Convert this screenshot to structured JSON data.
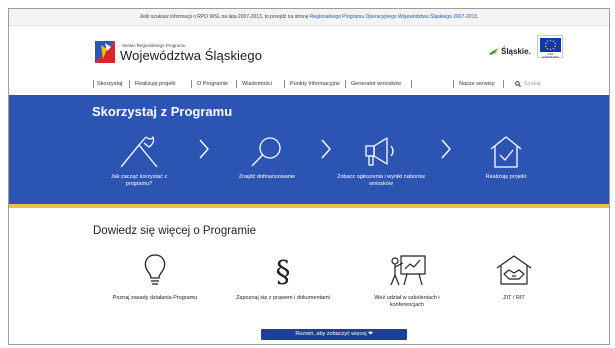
{
  "info_bar": {
    "prefix": "Jeśli szukasz informacji o RPO WSL na lata 2007-2013, to przejdź na stronę ",
    "link": "Regionalnego Programu Operacyjnego Województwa Śląskiego 2007-2013."
  },
  "header": {
    "subtitle": "Serwis Regionalnego Programu",
    "title": "Województwa Śląskiego",
    "brand": "Śląskie.",
    "eu_caption": "UNIA EUROPEJSKA"
  },
  "nav": {
    "items": [
      "Skorzystaj",
      "Realizuję projekt",
      "O Programie",
      "Wiadomości",
      "Punkty Informacyjne",
      "Generator wniosków"
    ],
    "services": "Nasze serwisy",
    "search_placeholder": "Szukaj"
  },
  "program": {
    "title": "Skorzystaj z Programu",
    "steps": [
      {
        "label": "Jak zacząć korzystać z programu?",
        "icon": "flag-icon"
      },
      {
        "label": "Znajdź dofinansowanie",
        "icon": "magnifier-icon"
      },
      {
        "label": "Zobacz ogłoszenia i wyniki naborów wniosków",
        "icon": "megaphone-icon"
      },
      {
        "label": "Realizuję projekt",
        "icon": "house-check-icon"
      }
    ]
  },
  "more": {
    "title": "Dowiedz się więcej o Programie",
    "tiles": [
      {
        "label": "Poznaj zasady działania Programu",
        "icon": "lightbulb-icon"
      },
      {
        "label": "Zapoznaj się z prawem i dokumentami",
        "icon": "paragraph-icon"
      },
      {
        "label": "Weź udział w szkoleniach i konferencjach",
        "icon": "presentation-icon"
      },
      {
        "label": "ZIT / RIT",
        "icon": "handshake-icon"
      }
    ],
    "expand_label": "Rozwiń, aby zobaczyć więcej ❤"
  },
  "colors": {
    "blue_band": "#2b54b3",
    "gold_stripe": "#e7c24a",
    "link": "#1f56b3",
    "button": "#1e3f95"
  }
}
